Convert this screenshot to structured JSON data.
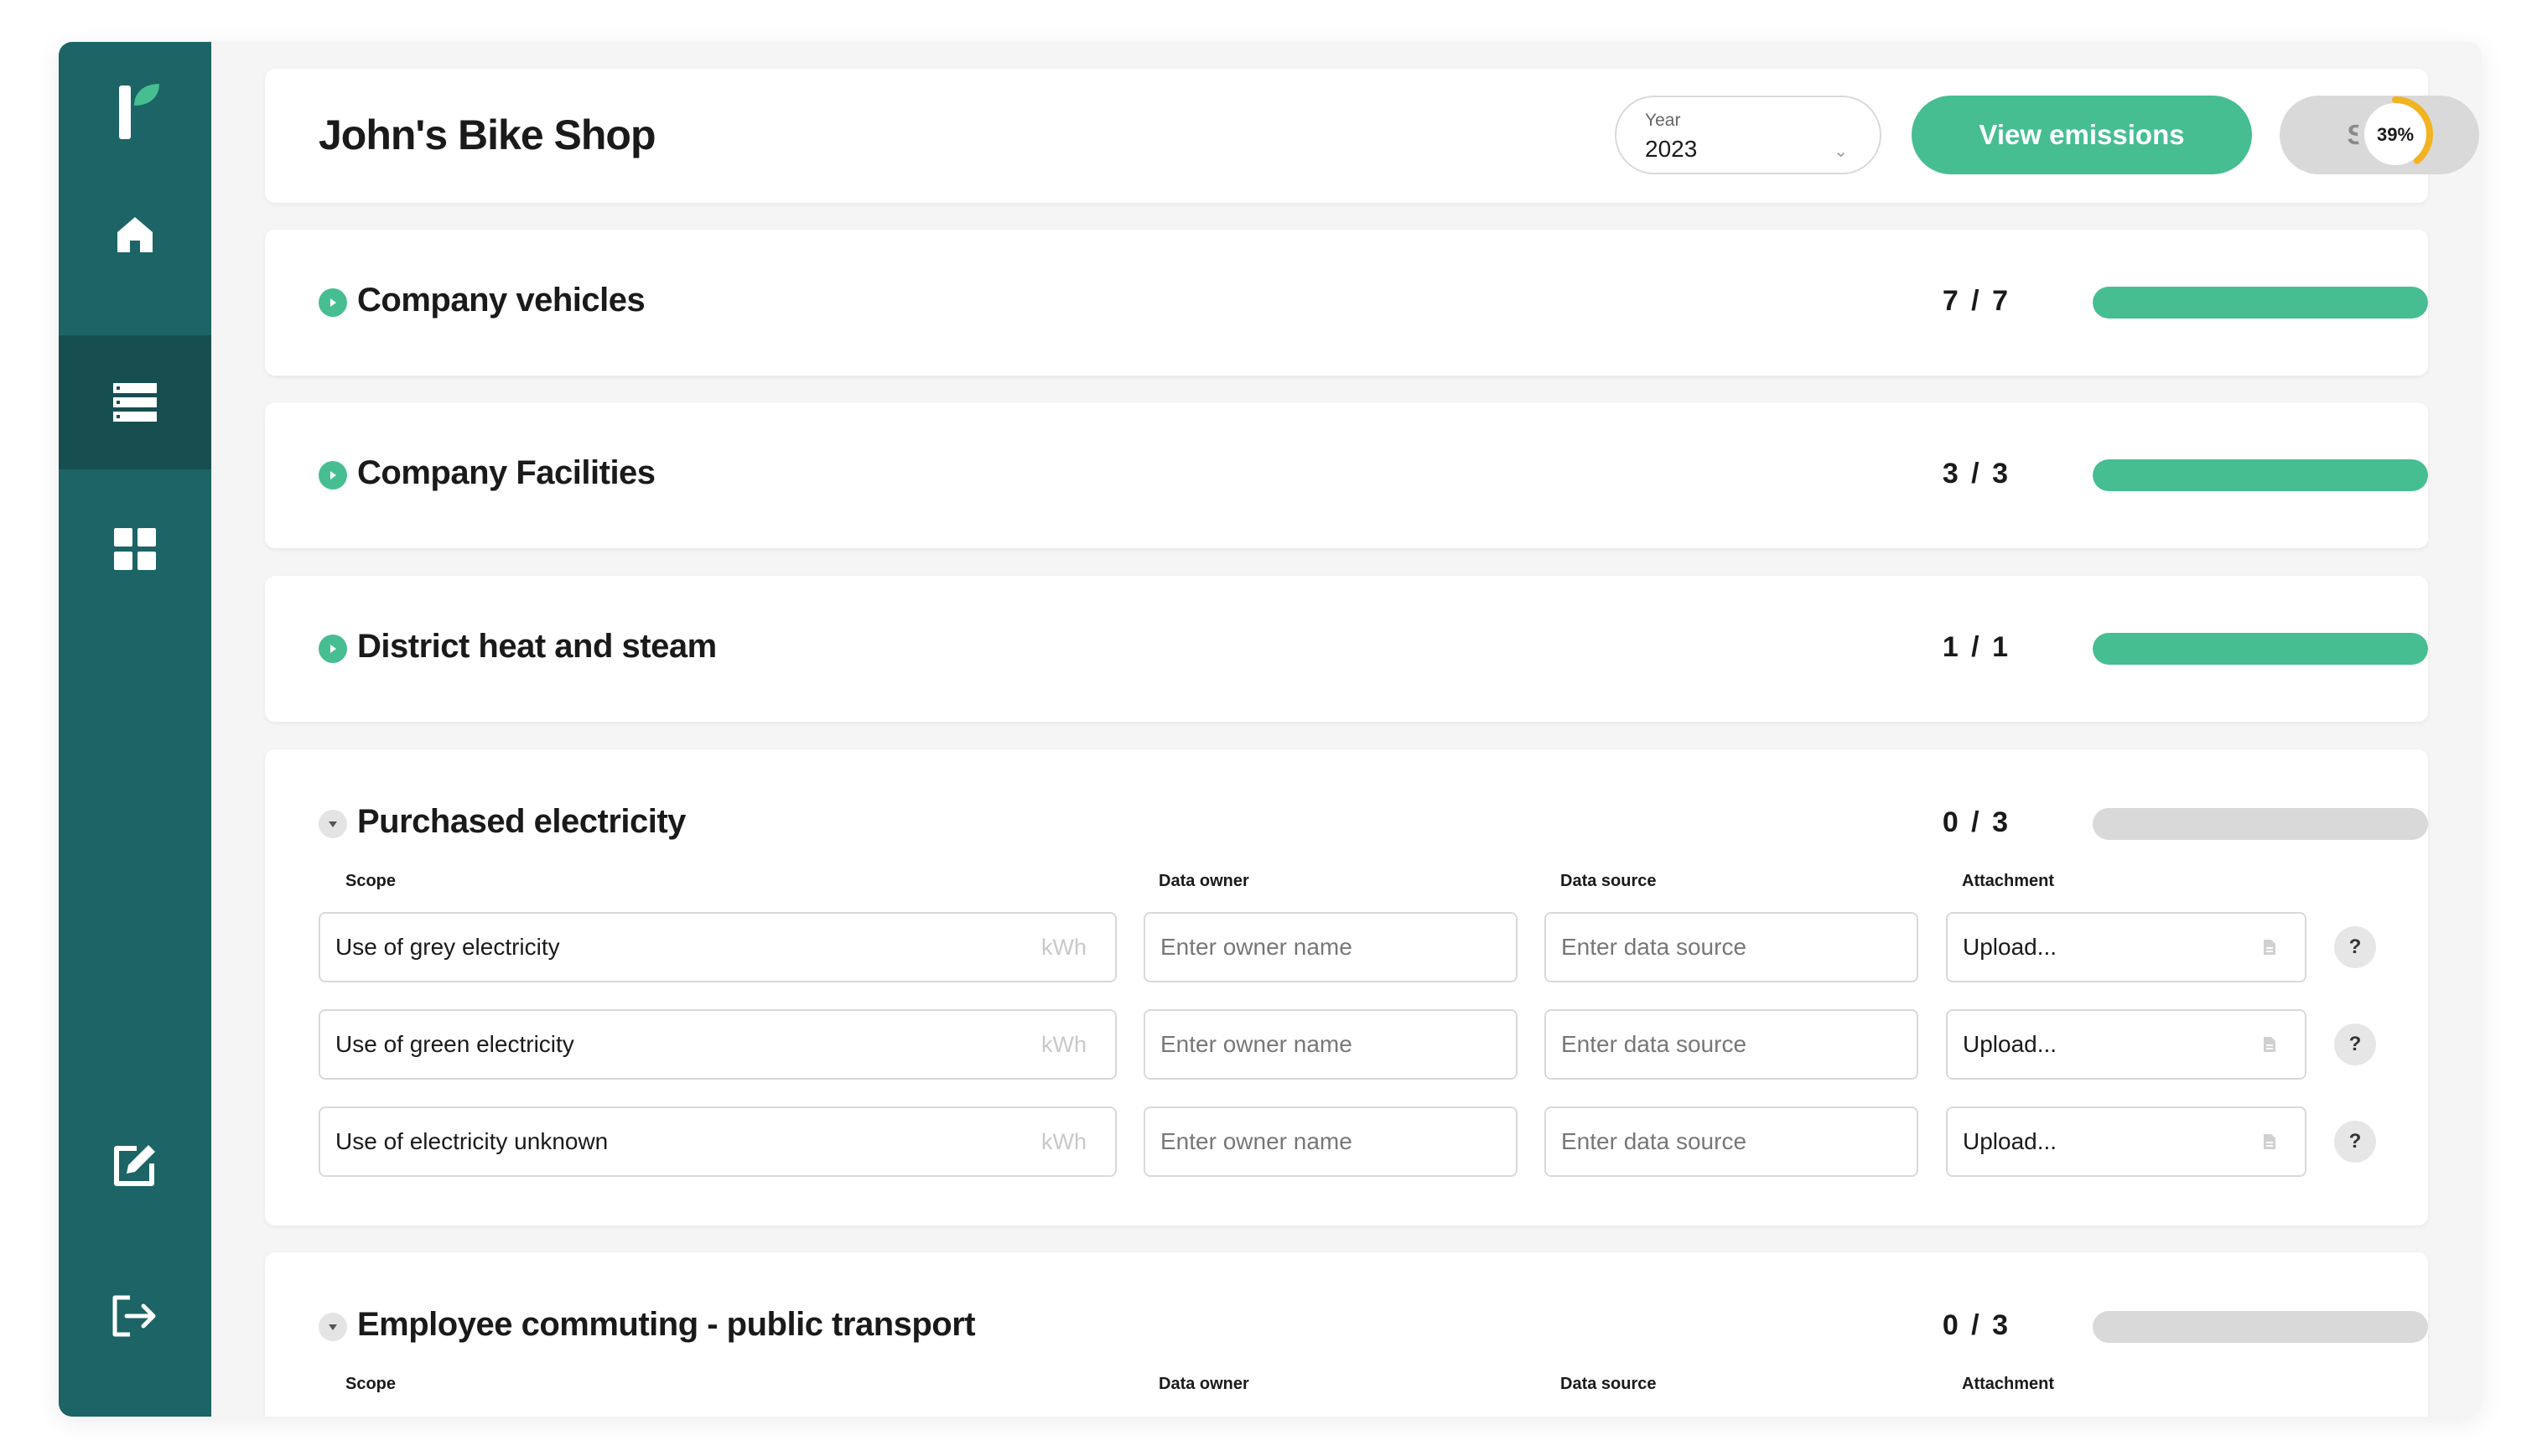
{
  "header": {
    "company_name": "John's Bike Shop",
    "year_label": "Year",
    "year_value": "2023",
    "view_emissions_label": "View emissions",
    "save_label": "Save",
    "progress_label": "39%",
    "progress_value": 0.39
  },
  "sidebar": {
    "items": [
      {
        "icon": "home-icon"
      },
      {
        "icon": "list-icon",
        "active": true
      },
      {
        "icon": "grid-icon"
      },
      {
        "icon": "edit-icon"
      },
      {
        "icon": "logout-icon"
      }
    ]
  },
  "columns": {
    "scope": "Scope",
    "owner": "Data owner",
    "source": "Data source",
    "attachment": "Attachment"
  },
  "sections": [
    {
      "title": "Company vehicles",
      "count": "7 / 7",
      "progress": 1.0,
      "expanded": false
    },
    {
      "title": "Company Facilities",
      "count": "3 / 3",
      "progress": 1.0,
      "expanded": false
    },
    {
      "title": "District heat and steam",
      "count": "1 / 1",
      "progress": 1.0,
      "expanded": false
    },
    {
      "title": "Purchased electricity",
      "count": "0 / 3",
      "progress": 0.0,
      "expanded": true,
      "rows": [
        {
          "scope": "Use of grey electricity",
          "unit": "kWh",
          "owner_placeholder": "Enter owner name",
          "source_placeholder": "Enter data source",
          "attachment": "Upload...",
          "help": "?"
        },
        {
          "scope": "Use of green electricity",
          "unit": "kWh",
          "owner_placeholder": "Enter owner name",
          "source_placeholder": "Enter data source",
          "attachment": "Upload...",
          "help": "?"
        },
        {
          "scope": "Use of electricity unknown",
          "unit": "kWh",
          "owner_placeholder": "Enter owner name",
          "source_placeholder": "Enter data source",
          "attachment": "Upload...",
          "help": "?"
        }
      ]
    },
    {
      "title": "Employee commuting - public transport",
      "count": "0 / 3",
      "progress": 0.0,
      "expanded": true
    }
  ],
  "colors": {
    "sidebar": "#1c6465",
    "sidebar_active": "#174f51",
    "accent": "#46be91",
    "ring_progress": "#f2b321",
    "muted": "#d9d9d9"
  }
}
